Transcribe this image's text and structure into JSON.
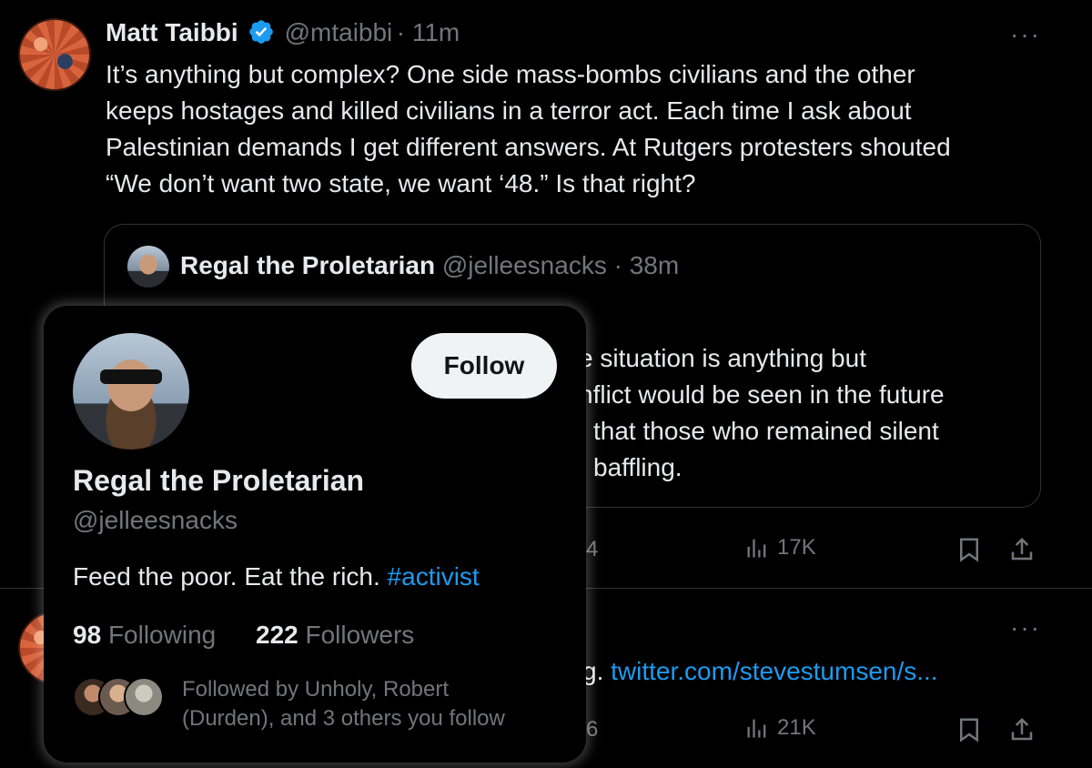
{
  "tweet": {
    "author_name": "Matt Taibbi",
    "handle": "@mtaibbi",
    "time": "· 11m",
    "more": "···",
    "lines": [
      "It’s anything but complex? One side mass-bombs civilians and the other",
      "keeps hostages and killed civilians in a terror act. Each time I ask about",
      "Palestinian demands I get different answers. At Rutgers protesters shouted",
      "“We don’t want two state, we want ‘48.” Is that right?"
    ],
    "views": "17K"
  },
  "quote": {
    "author_name": "Regal the Proletarian",
    "handle": "@jelleesnacks",
    "time": "· 38m",
    "visible_lines": [
      "e situation is anything but",
      "nflict would be seen in the future",
      "that those who remained silent",
      "baffling."
    ]
  },
  "second_tweet": {
    "more": "···",
    "text_fragment": "g.",
    "link": "twitter.com/stevestumsen/s...",
    "views": "21K",
    "partial_left": "4",
    "partial_left2": "6"
  },
  "hover_card": {
    "follow_label": "Follow",
    "name": "Regal the Proletarian",
    "handle": "@jelleesnacks",
    "bio_text": "Feed the poor. Eat the rich. ",
    "bio_hashtag": "#activist",
    "following_count": "98",
    "following_label": "Following",
    "followers_count": "222",
    "followers_label": "Followers",
    "followed_by_line1": "Followed by Unholy, Robert",
    "followed_by_line2": "(Durden), and 3 others you follow"
  },
  "colors": {
    "accent": "#1d9bf0",
    "muted": "#71767b",
    "text": "#e7e9ea",
    "background": "#000000"
  }
}
